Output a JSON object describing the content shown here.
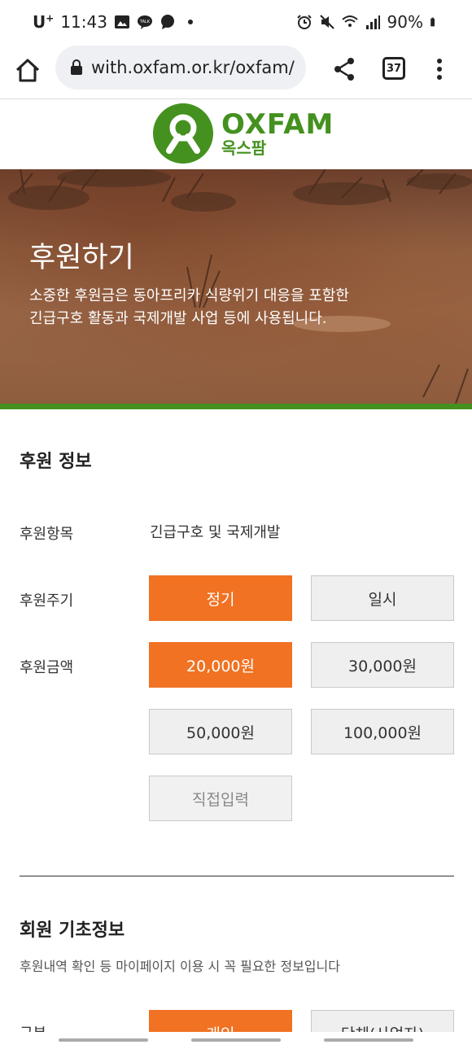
{
  "status_bar": {
    "carrier": "U",
    "carrier_sup": "+",
    "time": "11:43",
    "battery": "90%"
  },
  "browser": {
    "url": "with.oxfam.or.kr/oxfam/",
    "tab_count": "37"
  },
  "logo": {
    "name_en": "OXFAM",
    "name_ko": "옥스팜",
    "brand_color": "#44911f"
  },
  "hero": {
    "title": "후원하기",
    "description_line1": "소중한 후원금은 동아프리카 식량위기 대응을 포함한",
    "description_line2": "긴급구호 활동과 국제개발 사업 등에 사용됩니다."
  },
  "donation_info": {
    "section_title": "후원 정보",
    "item_label": "후원항목",
    "item_value": "긴급구호 및 국제개발",
    "cycle_label": "후원주기",
    "cycle_options": [
      "정기",
      "일시"
    ],
    "cycle_selected": "정기",
    "amount_label": "후원금액",
    "amount_options": [
      "20,000원",
      "30,000원",
      "50,000원",
      "100,000원"
    ],
    "amount_selected": "20,000원",
    "custom_amount_label": "직접입력",
    "accent_color": "#f07222"
  },
  "member_info": {
    "section_title": "회원 기초정보",
    "description": "후원내역 확인 등 마이페이지 이용 시 꼭 필요한 정보입니다",
    "type_label": "구분",
    "type_options": [
      "개인",
      "단체(사업자)"
    ]
  }
}
